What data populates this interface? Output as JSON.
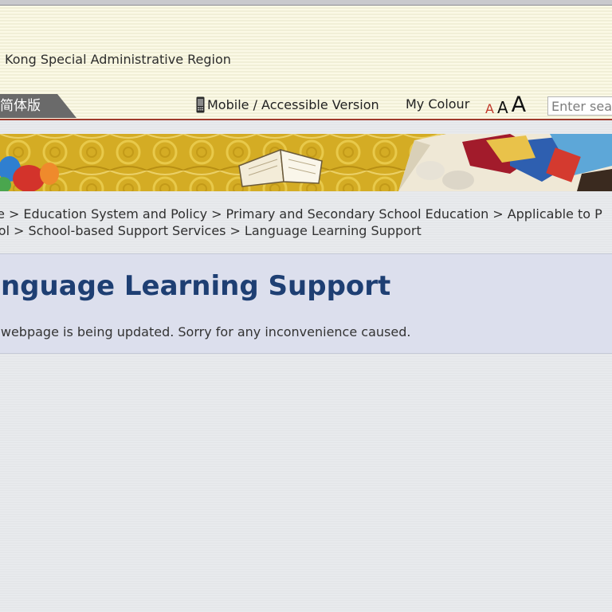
{
  "header": {
    "region_text": "Kong Special Administrative Region",
    "lang_tab_label": "简体版",
    "mobile_label": "Mobile / Accessible Version",
    "my_colour_label": "My Colour",
    "font_size_labels": [
      "A",
      "A",
      "A"
    ],
    "search_placeholder": "Enter search"
  },
  "breadcrumb": {
    "line1": [
      "ne",
      "Education System and Policy",
      "Primary and Secondary School Education",
      "Applicable to P"
    ],
    "line2": [
      "ool",
      "School-based Support Services",
      "Language Learning Support"
    ],
    "separator": ">"
  },
  "main": {
    "title": "anguage Learning Support",
    "notice": "is webpage is being updated. Sorry for any inconvenience caused."
  },
  "colors": {
    "title": "#1e3f73",
    "accent_line": "#9f3a2c",
    "small_font_a": "#c0392b"
  },
  "icons": {
    "phone": "mobile-phone-icon"
  }
}
